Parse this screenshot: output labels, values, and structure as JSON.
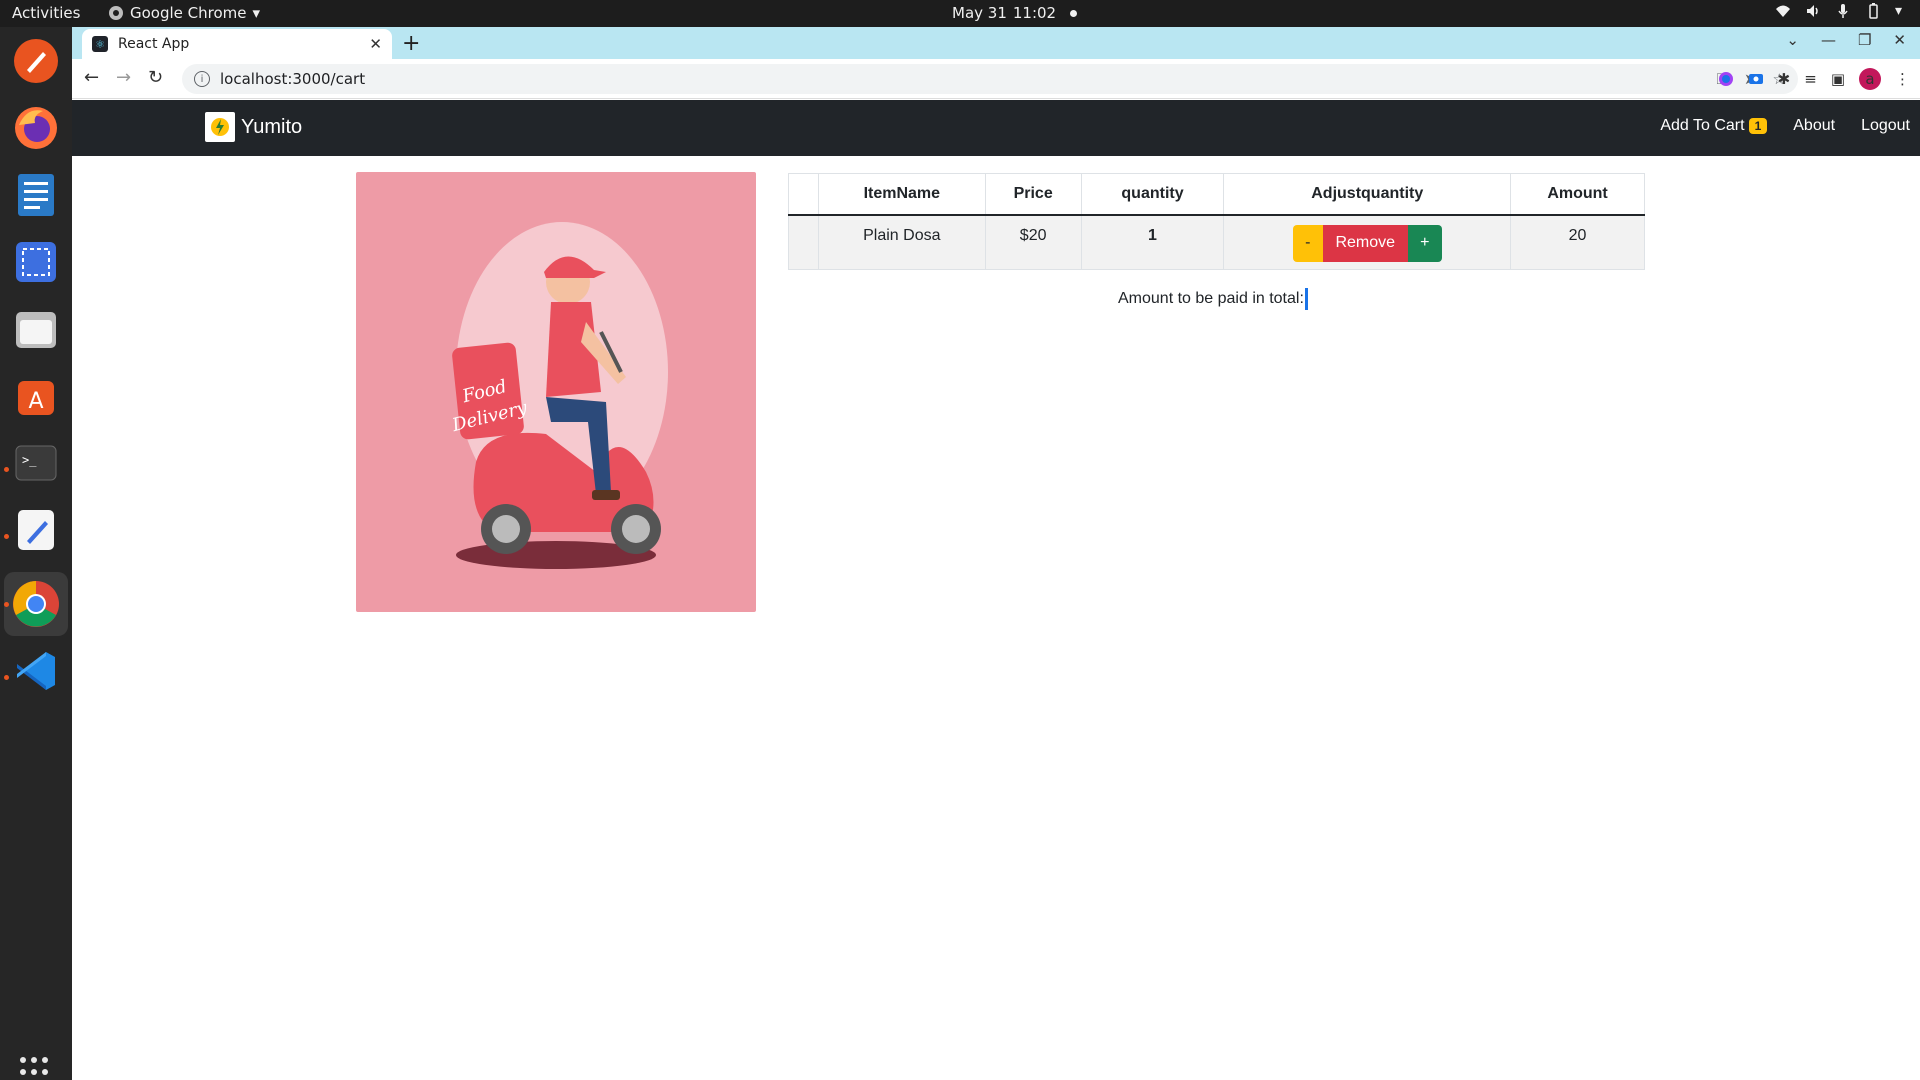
{
  "os": {
    "activities": "Activities",
    "app_menu": "Google Chrome",
    "date": "May 31",
    "time": "11:02"
  },
  "browser": {
    "tab_title": "React App",
    "url": "localhost:3000/cart"
  },
  "navbar": {
    "brand": "Yumito",
    "add_to_cart": "Add To Cart",
    "cart_count": "1",
    "about": "About",
    "logout": "Logout"
  },
  "hero": {
    "sign_line1": "Food",
    "sign_line2": "Delivery"
  },
  "table": {
    "headers": [
      "",
      "ItemName",
      "Price",
      "quantity",
      "Adjustquantity",
      "Amount"
    ],
    "rows": [
      {
        "index": "",
        "item_name": "Plain Dosa",
        "price": "$20",
        "quantity": "1",
        "amount": "20"
      }
    ],
    "buttons": {
      "minus": "-",
      "remove": "Remove",
      "plus": "+"
    }
  },
  "total_text": "Amount to be paid in total:",
  "colors": {
    "navbar_bg": "#212529",
    "hero_bg": "#ee9ba6",
    "warning": "#ffc107",
    "danger": "#dc3545",
    "success": "#198754"
  }
}
